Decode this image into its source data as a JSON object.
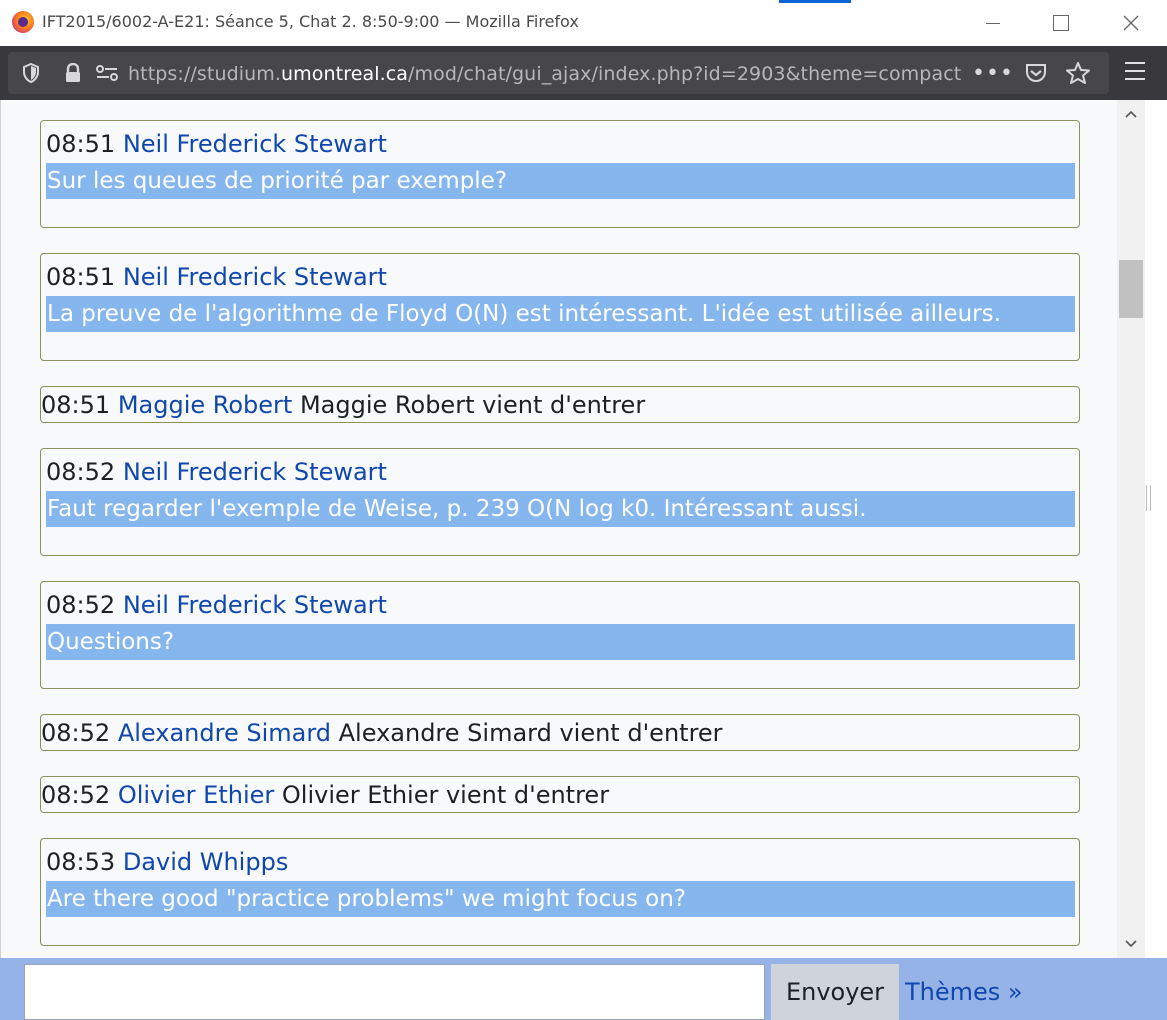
{
  "window": {
    "title": "IFT2015/6002-A-E21: Séance 5, Chat 2. 8:50-9:00 — Mozilla Firefox"
  },
  "browser": {
    "url_prefix": "https://studium.",
    "url_domain": "umontreal.ca",
    "url_suffix": "/mod/chat/gui_ajax/index.php?id=2903&theme=compact",
    "more_label": "•••"
  },
  "messages": [
    {
      "time": "08:51",
      "user": "Neil Frederick Stewart",
      "text": "Sur les queues de priorité par exemple?"
    },
    {
      "time": "08:51",
      "user": "Neil Frederick Stewart",
      "text": "La preuve de l'algorithme de Floyd O(N) est intéressant. L'idée est utilisée ailleurs."
    },
    {
      "time": "08:51",
      "user": "Maggie Robert",
      "system": "Maggie Robert vient d'entrer"
    },
    {
      "time": "08:52",
      "user": "Neil Frederick Stewart",
      "text": "Faut regarder l'exemple de Weise, p. 239 O(N log k0. Intéressant aussi."
    },
    {
      "time": "08:52",
      "user": "Neil Frederick Stewart",
      "text": "Questions?"
    },
    {
      "time": "08:52",
      "user": "Alexandre Simard",
      "system": "Alexandre Simard vient d'entrer"
    },
    {
      "time": "08:52",
      "user": "Olivier Ethier",
      "system": "Olivier Ethier vient d'entrer"
    },
    {
      "time": "08:53",
      "user": "David Whipps",
      "text": "Are there good \"practice problems\" we might focus on?"
    }
  ],
  "input": {
    "value": "",
    "send_label": "Envoyer",
    "themes_label": "Thèmes »"
  },
  "colors": {
    "message_highlight": "#86b6ee",
    "username": "#0f47ad",
    "input_bar": "#96b3e8"
  }
}
